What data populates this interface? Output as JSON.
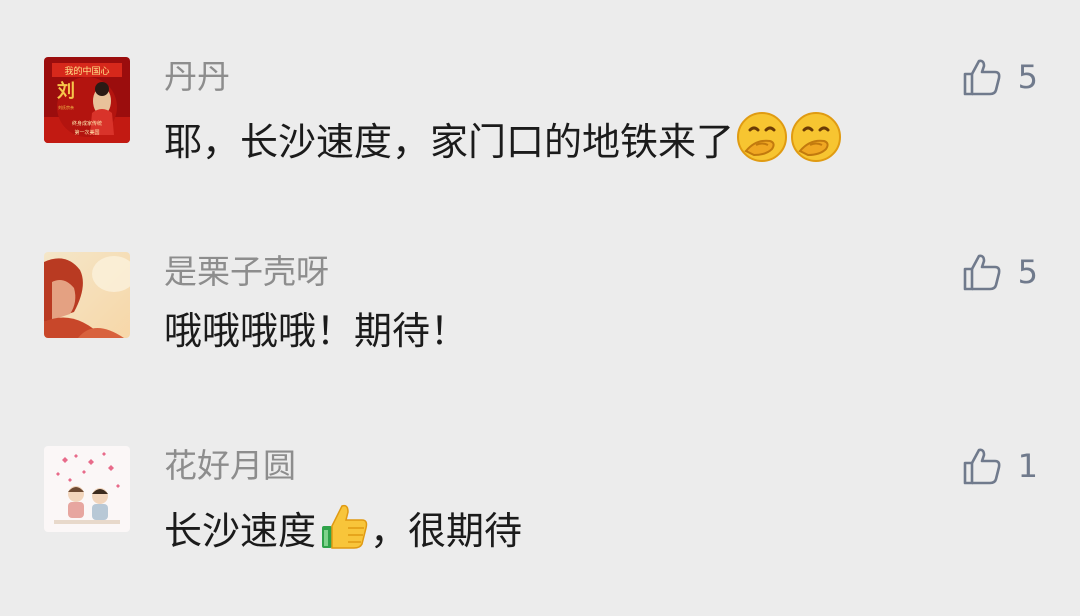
{
  "comments": [
    {
      "name": "丹丹",
      "text": "耶，长沙速度，家门口的地铁来了",
      "emojis": [
        "shushing-face",
        "shushing-face"
      ],
      "likes": "5",
      "avatar_text": {
        "banner": "我的中国心",
        "seal": "刘",
        "line1": "终身成家传统",
        "line2": "第一次美国",
        "small": "刘氏宗亲"
      }
    },
    {
      "name": "是栗子壳呀",
      "text_before": "哦哦哦哦！期待！",
      "likes": "5"
    },
    {
      "name": "花好月圆",
      "text_before": "长沙速度",
      "emoji_mid": "thumbs-up",
      "text_after": "，很期待",
      "likes": "1"
    }
  ],
  "colors": {
    "background": "#ececec",
    "name": "#8d8d8d",
    "text": "#1b1b1b",
    "like": "#707a8c"
  }
}
